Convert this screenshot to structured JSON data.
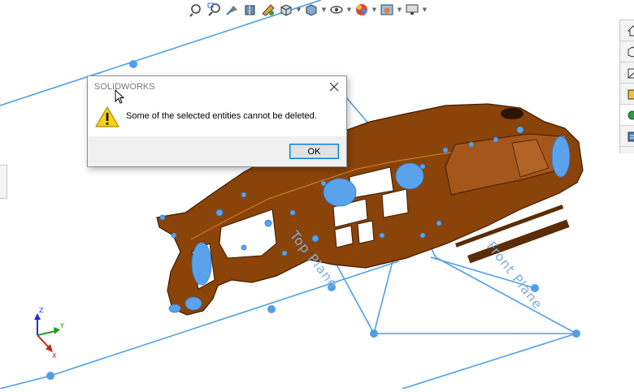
{
  "viewport": {
    "planes": {
      "top_plane_label": "Top Plane",
      "front_plane_label": "Front Plane"
    },
    "triad": {
      "x_label": "X",
      "y_label": "Y",
      "z_label": "Z"
    },
    "colors": {
      "part": "#8a4308",
      "plane": "#4f9fe8",
      "plane_label": "#7fb0e0",
      "background": "#ffffff"
    }
  },
  "heads_up_toolbar": {
    "buttons": [
      "zoom-to-fit-icon",
      "zoom-to-area-icon",
      "previous-view-icon",
      "section-view-icon",
      "dynamic-annotation-views-icon",
      "view-orientation-icon",
      "display-style-icon",
      "hide-show-items-icon",
      "edit-appearance-icon",
      "apply-scene-icon",
      "view-settings-icon"
    ]
  },
  "task_pane": {
    "tabs": [
      "home-icon",
      "part-icon",
      "file-explorer-icon",
      "view-palette-icon",
      "appearances-icon",
      "custom-properties-icon"
    ]
  },
  "dialog": {
    "title": "SOLIDWORKS",
    "message": "Some of the selected entities cannot be deleted.",
    "ok_label": "OK",
    "icon": "warning-icon"
  }
}
